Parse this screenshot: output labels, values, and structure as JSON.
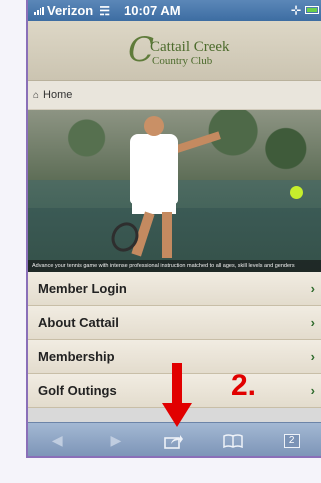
{
  "status_bar": {
    "carrier": "Verizon",
    "time": "10:07 AM"
  },
  "header": {
    "logo_line1": "Cattail Creek",
    "logo_line2": "Country Club"
  },
  "breadcrumb": {
    "home_label": "Home"
  },
  "hero": {
    "caption": "Advance your tennis game with intense professional instruction matched to all ages, skill levels and genders"
  },
  "menu": {
    "items": [
      {
        "label": "Member Login"
      },
      {
        "label": "About Cattail"
      },
      {
        "label": "Membership"
      },
      {
        "label": "Golf Outings"
      }
    ]
  },
  "toolbar": {
    "tabs_count": "2"
  },
  "overlay": {
    "step_label": "2.",
    "color": "#e10000"
  },
  "icons": [
    "home-icon",
    "back-icon",
    "forward-icon",
    "share-icon",
    "bookmarks-icon",
    "tabs-icon",
    "wifi-icon",
    "bluetooth-icon",
    "battery-icon"
  ]
}
